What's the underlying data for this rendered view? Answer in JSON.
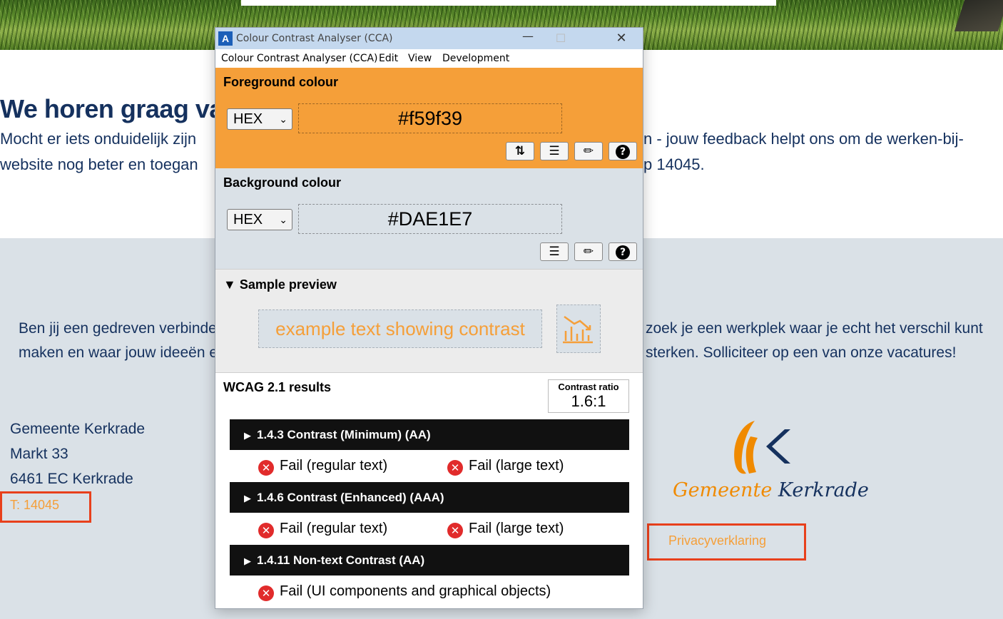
{
  "website": {
    "heading": "We horen graag va",
    "intro_line1_left": "Mocht er iets onduidelijk zijn",
    "intro_line1_right": "n - jouw feedback helpt ons om de werken-bij-",
    "intro_line2_left": "website nog beter en toegan",
    "intro_line2_right": "p 14045.",
    "footer_line1_left": "Ben jij een gedreven verbinde",
    "footer_line1_right": "zoek je een werkplek waar je echt het verschil kunt",
    "footer_line2_left": "maken en waar jouw ideeën e",
    "footer_line2_right": "sterken. Solliciteer op een van onze vacatures!",
    "address": [
      "Gemeente Kerkrade",
      "Markt 33",
      "6461 EC Kerkrade"
    ],
    "phone": "T: 14045",
    "privacy_link": "Privacyverklaring",
    "logo_word1": "Gemeente",
    "logo_word2": "Kerkrade"
  },
  "cca": {
    "title": "Colour Contrast Analyser (CCA)",
    "menu": [
      "Colour Contrast Analyser (CCA)",
      "Edit",
      "View",
      "Development"
    ],
    "foreground": {
      "title": "Foreground colour",
      "format": "HEX",
      "value": "#f59f39",
      "color": "#f59f39"
    },
    "background": {
      "title": "Background colour",
      "format": "HEX",
      "value": "#DAE1E7",
      "color": "#dae1e7"
    },
    "preview": {
      "title": "Sample preview",
      "sample_text": "example text showing contrast"
    },
    "results": {
      "title": "WCAG 2.1 results",
      "ratio_label": "Contrast ratio",
      "ratio_value": "1.6:1",
      "criteria": [
        {
          "name": "1.4.3 Contrast (Minimum) (AA)",
          "results": [
            "Fail (regular text)",
            "Fail (large text)"
          ]
        },
        {
          "name": "1.4.6 Contrast (Enhanced) (AAA)",
          "results": [
            "Fail (regular text)",
            "Fail (large text)"
          ]
        },
        {
          "name": "1.4.11 Non-text Contrast (AA)",
          "results": [
            "Fail (UI components and graphical objects)"
          ]
        }
      ]
    },
    "icons": {
      "swap": "swap-arrows-icon",
      "sliders": "sliders-icon",
      "picker": "eyedropper-icon",
      "help": "help-icon",
      "chart": "chart-icon",
      "fail": "fail-x-icon"
    }
  }
}
